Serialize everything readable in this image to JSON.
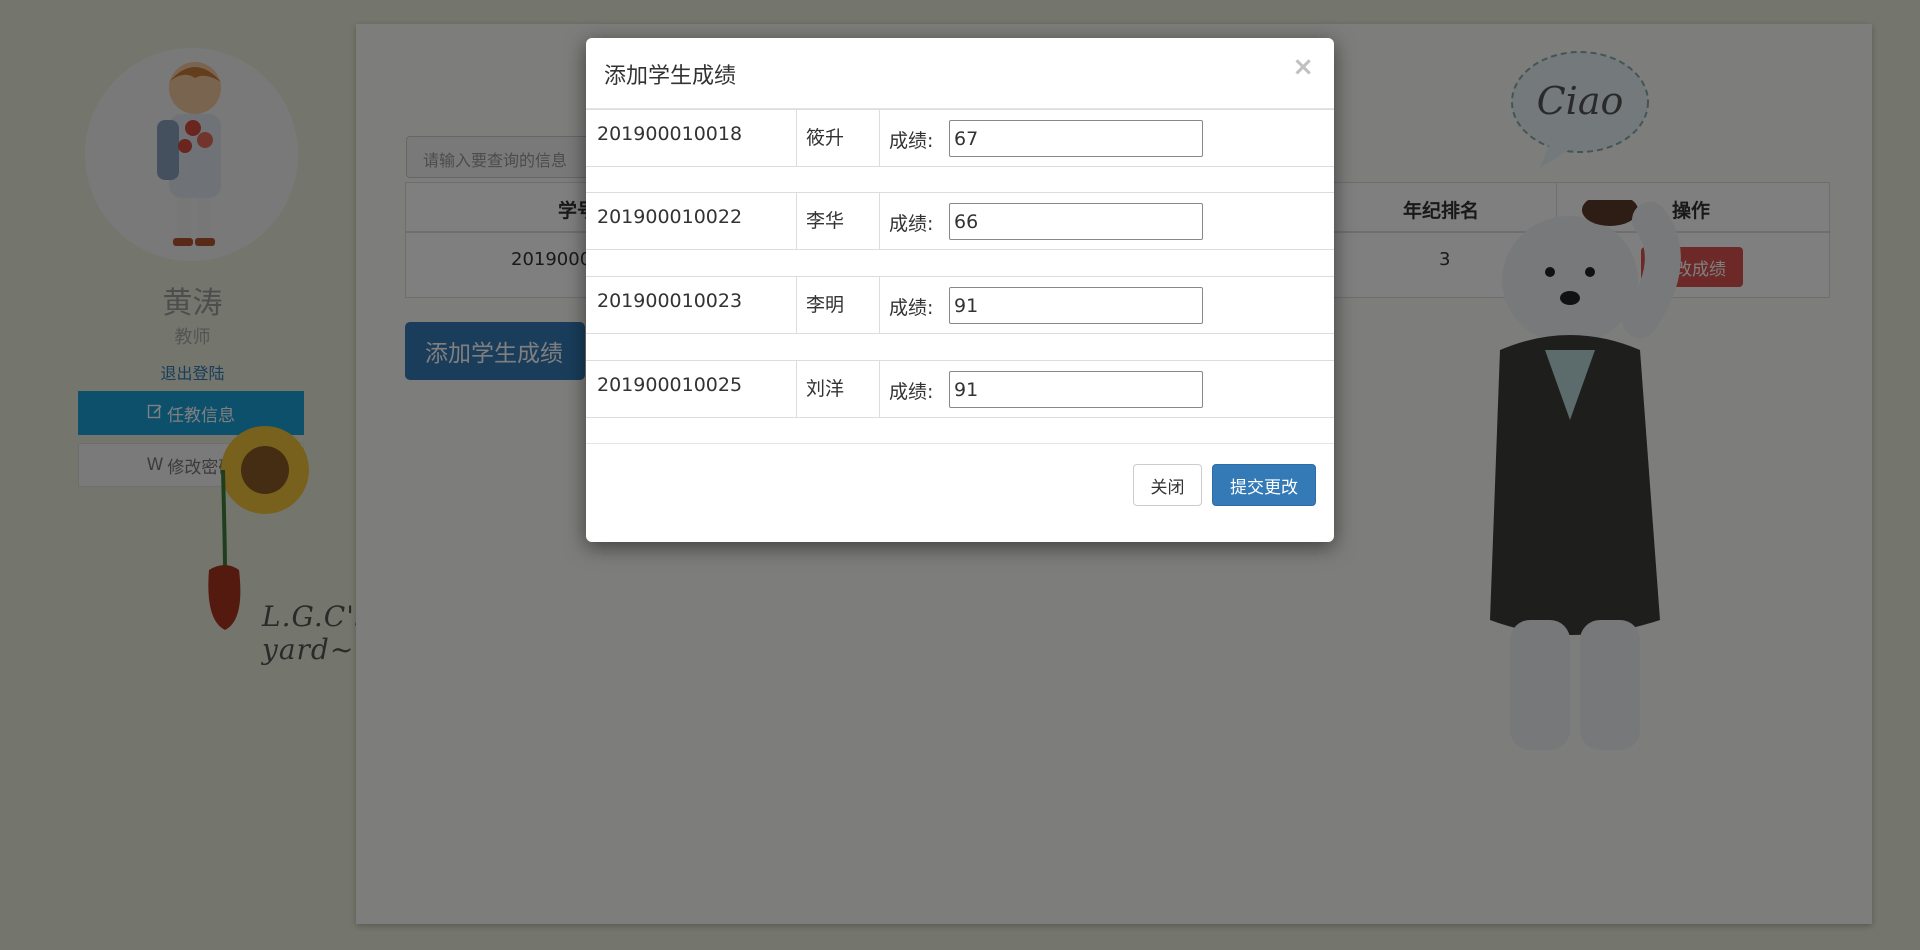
{
  "sidebar": {
    "username": "黄涛",
    "role": "教师",
    "logout": "退出登陆",
    "nav": [
      {
        "label": "任教信息",
        "icon": "edit-icon"
      },
      {
        "label": "修改密码",
        "icon": "w-icon",
        "prefix": "W"
      }
    ],
    "signature": "L.G.C's yard~"
  },
  "main": {
    "search_placeholder": "请输入要查询的信息",
    "table": {
      "headers": [
        "学号",
        "年纪排名",
        "操作"
      ],
      "row": {
        "id_partial": "2019000",
        "rank": "3",
        "action": "修改成绩"
      }
    },
    "add_button": "添加学生成绩",
    "bubble_text": "Ciao"
  },
  "modal": {
    "title": "添加学生成绩",
    "close_symbol": "×",
    "score_label": "成绩:",
    "students": [
      {
        "id": "201900010018",
        "name": "筱升",
        "score": "67"
      },
      {
        "id": "201900010022",
        "name": "李华",
        "score": "66"
      },
      {
        "id": "201900010023",
        "name": "李明",
        "score": "91"
      },
      {
        "id": "201900010025",
        "name": "刘洋",
        "score": "91"
      }
    ],
    "close_button": "关闭",
    "submit_button": "提交更改"
  },
  "colors": {
    "primary": "#337ab7",
    "danger": "#d9534f",
    "nav_active": "#1aa0d8",
    "backdrop": "rgba(0,0,0,0.5)"
  }
}
